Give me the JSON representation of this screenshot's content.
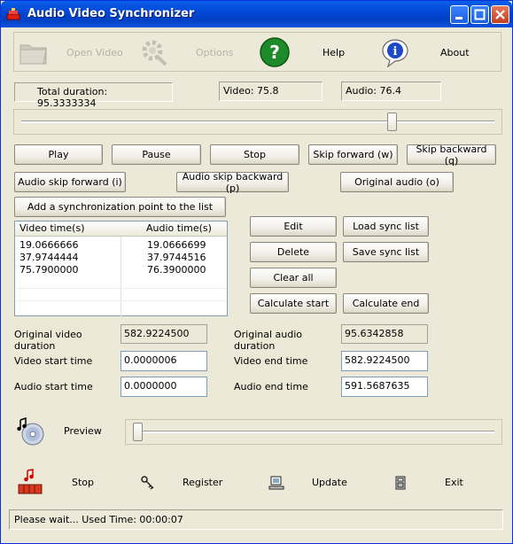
{
  "window": {
    "title": "Audio Video Synchronizer"
  },
  "toolbar": {
    "open_video": "Open Video",
    "options": "Options",
    "help": "Help",
    "about": "About"
  },
  "durations": {
    "total": "Total duration: 95.3333334",
    "video": "Video: 75.8",
    "audio": "Audio: 76.4"
  },
  "main_slider": {
    "position_fraction": 0.79
  },
  "buttons": {
    "play": "Play",
    "pause": "Pause",
    "stop": "Stop",
    "skip_forward": "Skip forward (w)",
    "skip_backward": "Skip backward (q)",
    "audio_skip_forward": "Audio skip forward (i)",
    "audio_skip_backward": "Audio skip backward (p)",
    "original_audio": "Original audio (o)",
    "add_sync": "Add a synchronization point to the list",
    "edit": "Edit",
    "load_sync": "Load sync list",
    "delete": "Delete",
    "save_sync": "Save sync list",
    "clear_all": "Clear all",
    "calc_start": "Calculate start",
    "calc_end": "Calculate end"
  },
  "sync_list": {
    "columns": [
      "Video time(s)",
      "Audio time(s)"
    ],
    "rows": [
      [
        "19.0666666",
        "19.0666699"
      ],
      [
        "37.9744444",
        "37.9744516"
      ],
      [
        "75.7900000",
        "76.3900000"
      ]
    ]
  },
  "fields": {
    "orig_video_duration_label": "Original video duration",
    "orig_video_duration": "582.9224500",
    "orig_audio_duration_label": "Original audio duration",
    "orig_audio_duration": "95.6342858",
    "video_start_label": "Video start time",
    "video_start": "0.0000006",
    "video_end_label": "Video end time",
    "video_end": "582.9224500",
    "audio_start_label": "Audio start time",
    "audio_start": "0.0000000",
    "audio_end_label": "Audio end time",
    "audio_end": "591.5687635"
  },
  "preview": {
    "label": "Preview",
    "position_fraction": 0.0
  },
  "bottom_bar": {
    "stop": "Stop",
    "register": "Register",
    "update": "Update",
    "exit": "Exit"
  },
  "status": "Please wait... Used Time: 00:00:07"
}
